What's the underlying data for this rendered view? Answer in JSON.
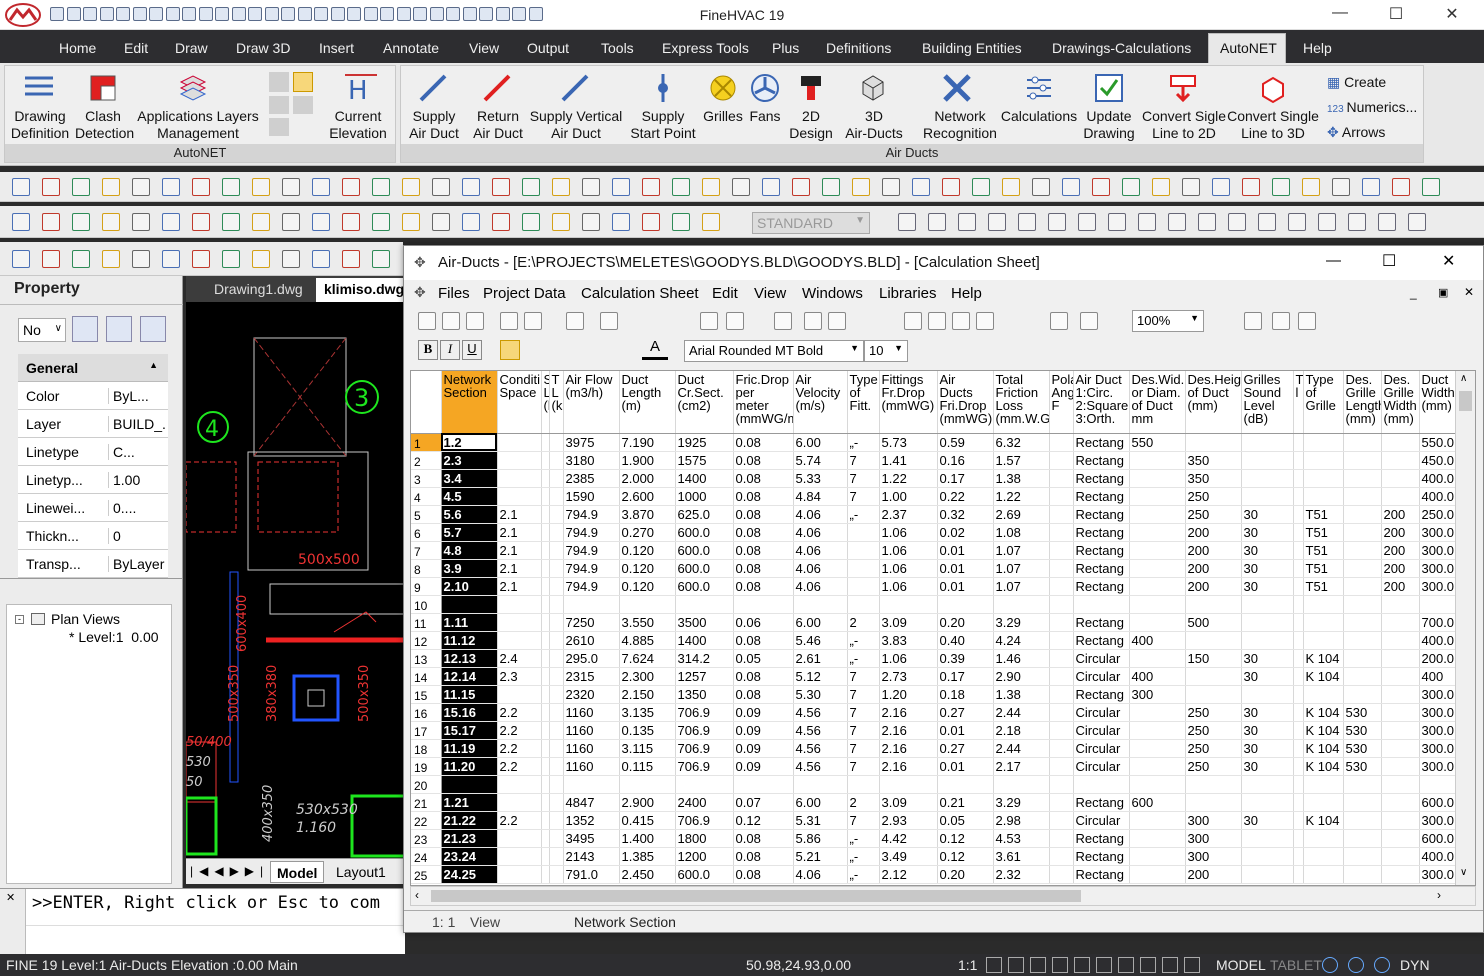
{
  "app": {
    "title": "FineHVAC 19"
  },
  "menu": [
    "Home",
    "Edit",
    "Draw",
    "Draw 3D",
    "Insert",
    "Annotate",
    "View",
    "Output",
    "Tools",
    "Express Tools",
    "Plus",
    "Definitions",
    "Building Entities",
    "Drawings-Calculations",
    "AutoNET",
    "Help"
  ],
  "ribbon": {
    "autonet_group": {
      "title": "AutoNET",
      "buttons": [
        {
          "l1": "Drawing",
          "l2": "Definition"
        },
        {
          "l1": "Clash",
          "l2": "Detection"
        },
        {
          "l1": "Applications Layers",
          "l2": "Management"
        },
        {
          "l1": "Current",
          "l2": "Elevation"
        }
      ]
    },
    "airducts_group": {
      "title": "Air Ducts",
      "buttons": [
        {
          "l1": "Supply",
          "l2": "Air Duct"
        },
        {
          "l1": "Return",
          "l2": "Air Duct"
        },
        {
          "l1": "Supply Vertical",
          "l2": "Air Duct"
        },
        {
          "l1": "Supply",
          "l2": "Start Point"
        },
        {
          "l1": "Grilles",
          "l2": ""
        },
        {
          "l1": "Fans",
          "l2": ""
        },
        {
          "l1": "2D",
          "l2": "Design"
        },
        {
          "l1": "3D",
          "l2": "Air-Ducts"
        },
        {
          "l1": "Network",
          "l2": "Recognition"
        },
        {
          "l1": "Calculations",
          "l2": ""
        },
        {
          "l1": "Update",
          "l2": "Drawing"
        },
        {
          "l1": "Convert Sigle",
          "l2": "Line to 2D"
        },
        {
          "l1": "Convert Single",
          "l2": "Line to 3D"
        }
      ]
    },
    "side": {
      "create": "Create",
      "numerics": "Numerics...",
      "arrows": "Arrows"
    }
  },
  "toolbar": {
    "layer_combo": "STANDARD"
  },
  "property_panel": {
    "title": "Property",
    "selector": "No",
    "section": "General",
    "rows": [
      {
        "label": "Color",
        "value": "ByL..."
      },
      {
        "label": "Layer",
        "value": "BUILD_..."
      },
      {
        "label": "Linetype",
        "value": "C..."
      },
      {
        "label": "Linetyp...",
        "value": "1.00"
      },
      {
        "label": "Linewei...",
        "value": "0...."
      },
      {
        "label": "Thickn...",
        "value": "0"
      },
      {
        "label": "Transp...",
        "value": "ByLayer"
      }
    ],
    "tree_root": "Plan Views",
    "tree_child": "* Level:1  0.00"
  },
  "drawing": {
    "tabs": [
      "Drawing1.dwg",
      "klimiso.dwg"
    ],
    "bottom_tabs": [
      "Model",
      "Layout1"
    ],
    "labels": [
      "3",
      "4",
      "500x500",
      "600x400",
      "500x350",
      "380x380",
      "500x350",
      "530x530",
      "1.160",
      "400x350",
      "50/400",
      "530",
      "50"
    ]
  },
  "command": {
    "text": ">>ENTER, Right click or Esc to com"
  },
  "status": {
    "left": "FINE 19 Level:1  Air-Ducts Elevation :0.00 Main",
    "coords": "50.98,24.93,0.00",
    "scale": "1:1",
    "model": "MODEL",
    "tablet": "TABLET",
    "dyn": "DYN"
  },
  "sheet": {
    "title": "Air-Ducts - [E:\\PROJECTS\\MELETES\\GOODYS.BLD\\GOODYS.BLD] - [Calculation Sheet]",
    "menu": [
      "Files",
      "Project Data",
      "Calculation Sheet",
      "Edit",
      "View",
      "Windows",
      "Libraries",
      "Help"
    ],
    "zoom": "100%",
    "font": "Arial Rounded MT Bold",
    "font_size": "10",
    "status": {
      "pos": "1: 1",
      "mode": "View",
      "field": "Network Section"
    },
    "columns": [
      "Network Section",
      "Conditi Space",
      "S L (k",
      "T L (k",
      "Air Flow (m3/h)",
      "Duct Length (m)",
      "Duct Cr.Sect. (cm2)",
      "Fric.Drop per meter (mmWG/m)",
      "Air Velocity (m/s)",
      "Type of Fitt.",
      "Fittings Fr.Drop (mmWG)",
      "Air Ducts Fri.Drop (mmWG)",
      "Total Friction Loss (mm.W.G)",
      "Pola Ang F",
      "Air Duct 1:Circ. 2:Square 3:Orth.",
      "Des.Wid. or Diam. of Duct mm",
      "Des.Heig of Duct (mm)",
      "Grilles Sound Level (dB)",
      "T l",
      "Type of Grille",
      "Des. Grille Length (mm)",
      "Des. Grille Width (mm)",
      "Duct Width (mm)"
    ],
    "rows": [
      [
        "1",
        "1.2",
        "",
        "",
        "",
        "3975",
        "7.190",
        "1925",
        "0.08",
        "6.00",
        "„-",
        "5.73",
        "0.59",
        "6.32",
        "",
        "Rectang",
        "550",
        "",
        "",
        "",
        "",
        "",
        "",
        "550.0"
      ],
      [
        "2",
        "2.3",
        "",
        "",
        "",
        "3180",
        "1.900",
        "1575",
        "0.08",
        "5.74",
        "7",
        "1.41",
        "0.16",
        "1.57",
        "",
        "Rectang",
        "",
        "350",
        "",
        "",
        "",
        "",
        "",
        "450.0"
      ],
      [
        "3",
        "3.4",
        "",
        "",
        "",
        "2385",
        "2.000",
        "1400",
        "0.08",
        "5.33",
        "7",
        "1.22",
        "0.17",
        "1.38",
        "",
        "Rectang",
        "",
        "350",
        "",
        "",
        "",
        "",
        "",
        "400.0"
      ],
      [
        "4",
        "4.5",
        "",
        "",
        "",
        "1590",
        "2.600",
        "1000",
        "0.08",
        "4.84",
        "7",
        "1.00",
        "0.22",
        "1.22",
        "",
        "Rectang",
        "",
        "250",
        "",
        "",
        "",
        "",
        "",
        "400.0"
      ],
      [
        "5",
        "5.6",
        "2.1",
        "",
        "",
        "794.9",
        "3.870",
        "625.0",
        "0.08",
        "4.06",
        "„-",
        "2.37",
        "0.32",
        "2.69",
        "",
        "Rectang",
        "",
        "250",
        "30",
        "",
        "T51",
        "",
        "200",
        "250.0"
      ],
      [
        "6",
        "5.7",
        "2.1",
        "",
        "",
        "794.9",
        "0.270",
        "600.0",
        "0.08",
        "4.06",
        "",
        "1.06",
        "0.02",
        "1.08",
        "",
        "Rectang",
        "",
        "200",
        "30",
        "",
        "T51",
        "",
        "200",
        "300.0"
      ],
      [
        "7",
        "4.8",
        "2.1",
        "",
        "",
        "794.9",
        "0.120",
        "600.0",
        "0.08",
        "4.06",
        "",
        "1.06",
        "0.01",
        "1.07",
        "",
        "Rectang",
        "",
        "200",
        "30",
        "",
        "T51",
        "",
        "200",
        "300.0"
      ],
      [
        "8",
        "3.9",
        "2.1",
        "",
        "",
        "794.9",
        "0.120",
        "600.0",
        "0.08",
        "4.06",
        "",
        "1.06",
        "0.01",
        "1.07",
        "",
        "Rectang",
        "",
        "200",
        "30",
        "",
        "T51",
        "",
        "200",
        "300.0"
      ],
      [
        "9",
        "2.10",
        "2.1",
        "",
        "",
        "794.9",
        "0.120",
        "600.0",
        "0.08",
        "4.06",
        "",
        "1.06",
        "0.01",
        "1.07",
        "",
        "Rectang",
        "",
        "200",
        "30",
        "",
        "T51",
        "",
        "200",
        "300.0"
      ],
      [
        "10",
        "",
        "",
        "",
        "",
        "",
        "",
        "",
        "",
        "",
        "",
        "",
        "",
        "",
        "",
        "",
        "",
        "",
        "",
        "",
        "",
        "",
        "",
        ""
      ],
      [
        "11",
        "1.11",
        "",
        "",
        "",
        "7250",
        "3.550",
        "3500",
        "0.06",
        "6.00",
        "2",
        "3.09",
        "0.20",
        "3.29",
        "",
        "Rectang",
        "",
        "500",
        "",
        "",
        "",
        "",
        "",
        "700.0"
      ],
      [
        "12",
        "11.12",
        "",
        "",
        "",
        "2610",
        "4.885",
        "1400",
        "0.08",
        "5.46",
        "„-",
        "3.83",
        "0.40",
        "4.24",
        "",
        "Rectang",
        "400",
        "",
        "",
        "",
        "",
        "",
        "",
        "400.0"
      ],
      [
        "13",
        "12.13",
        "2.4",
        "",
        "",
        "295.0",
        "7.624",
        "314.2",
        "0.05",
        "2.61",
        "„-",
        "1.06",
        "0.39",
        "1.46",
        "",
        "Circular",
        "",
        "150",
        "30",
        "",
        "K 104",
        "",
        "",
        "200.0"
      ],
      [
        "14",
        "12.14",
        "2.3",
        "",
        "",
        "2315",
        "2.300",
        "1257",
        "0.08",
        "5.12",
        "7",
        "2.73",
        "0.17",
        "2.90",
        "",
        "Circular",
        "400",
        "",
        "30",
        "",
        "K 104",
        "",
        "",
        "400"
      ],
      [
        "15",
        "11.15",
        "",
        "",
        "",
        "2320",
        "2.150",
        "1350",
        "0.08",
        "5.30",
        "7",
        "1.20",
        "0.18",
        "1.38",
        "",
        "Rectang",
        "300",
        "",
        "",
        "",
        "",
        "",
        "",
        "300.0"
      ],
      [
        "16",
        "15.16",
        "2.2",
        "",
        "",
        "1160",
        "3.135",
        "706.9",
        "0.09",
        "4.56",
        "7",
        "2.16",
        "0.27",
        "2.44",
        "",
        "Circular",
        "",
        "250",
        "30",
        "",
        "K 104",
        "530",
        "",
        "300.0"
      ],
      [
        "17",
        "15.17",
        "2.2",
        "",
        "",
        "1160",
        "0.135",
        "706.9",
        "0.09",
        "4.56",
        "7",
        "2.16",
        "0.01",
        "2.18",
        "",
        "Circular",
        "",
        "250",
        "30",
        "",
        "K 104",
        "530",
        "",
        "300.0"
      ],
      [
        "18",
        "11.19",
        "2.2",
        "",
        "",
        "1160",
        "3.115",
        "706.9",
        "0.09",
        "4.56",
        "7",
        "2.16",
        "0.27",
        "2.44",
        "",
        "Circular",
        "",
        "250",
        "30",
        "",
        "K 104",
        "530",
        "",
        "300.0"
      ],
      [
        "19",
        "11.20",
        "2.2",
        "",
        "",
        "1160",
        "0.115",
        "706.9",
        "0.09",
        "4.56",
        "7",
        "2.16",
        "0.01",
        "2.17",
        "",
        "Circular",
        "",
        "250",
        "30",
        "",
        "K 104",
        "530",
        "",
        "300.0"
      ],
      [
        "20",
        "",
        "",
        "",
        "",
        "",
        "",
        "",
        "",
        "",
        "",
        "",
        "",
        "",
        "",
        "",
        "",
        "",
        "",
        "",
        "",
        "",
        "",
        ""
      ],
      [
        "21",
        "1.21",
        "",
        "",
        "",
        "4847",
        "2.900",
        "2400",
        "0.07",
        "6.00",
        "2",
        "3.09",
        "0.21",
        "3.29",
        "",
        "Rectang",
        "600",
        "",
        "",
        "",
        "",
        "",
        "",
        "600.0"
      ],
      [
        "22",
        "21.22",
        "2.2",
        "",
        "",
        "1352",
        "0.415",
        "706.9",
        "0.12",
        "5.31",
        "7",
        "2.93",
        "0.05",
        "2.98",
        "",
        "Circular",
        "",
        "300",
        "30",
        "",
        "K 104",
        "",
        "",
        "300.0"
      ],
      [
        "23",
        "21.23",
        "",
        "",
        "",
        "3495",
        "1.400",
        "1800",
        "0.08",
        "5.86",
        "„-",
        "4.42",
        "0.12",
        "4.53",
        "",
        "Rectang",
        "",
        "300",
        "",
        "",
        "",
        "",
        "",
        "600.0"
      ],
      [
        "24",
        "23.24",
        "",
        "",
        "",
        "2143",
        "1.385",
        "1200",
        "0.08",
        "5.21",
        "„-",
        "3.49",
        "0.12",
        "3.61",
        "",
        "Rectang",
        "",
        "300",
        "",
        "",
        "",
        "",
        "",
        "400.0"
      ],
      [
        "25",
        "24.25",
        "",
        "",
        "",
        "791.0",
        "2.450",
        "600.0",
        "0.08",
        "4.06",
        "„-",
        "2.12",
        "0.20",
        "2.32",
        "",
        "Rectang",
        "",
        "200",
        "",
        "",
        "",
        "",
        "",
        "300.0"
      ]
    ]
  }
}
